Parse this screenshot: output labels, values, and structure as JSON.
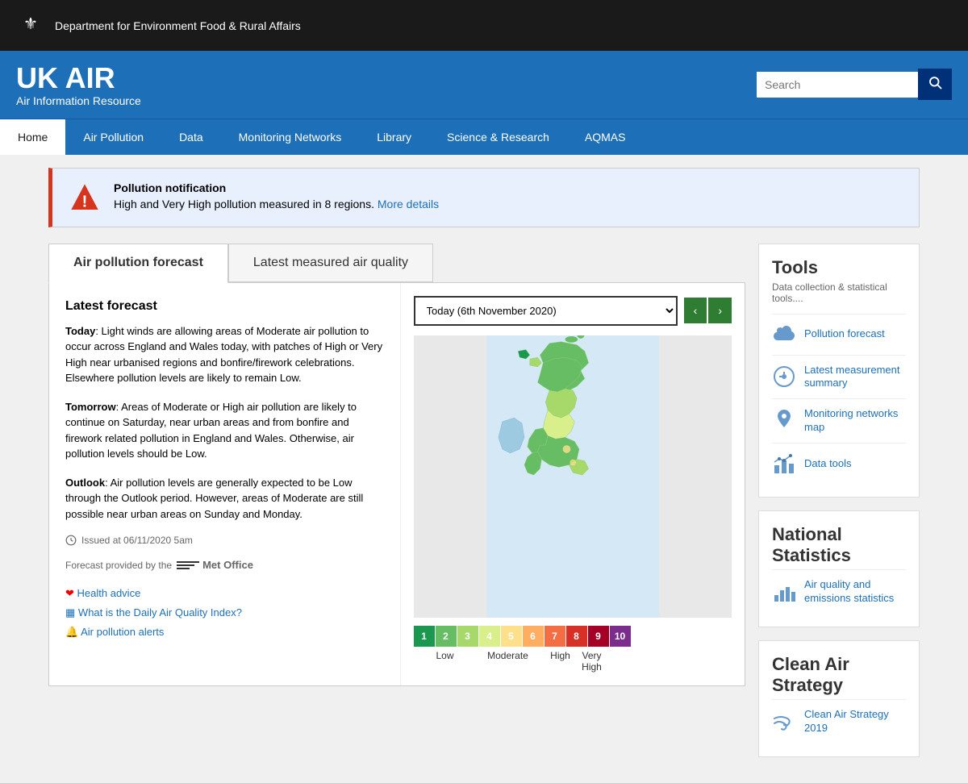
{
  "govbar": {
    "crest": "⚜",
    "dept": "Department for Environment Food & Rural Affairs"
  },
  "header": {
    "title": "UK AIR",
    "tagline": "Air Information Resource",
    "search_placeholder": "Search",
    "search_label": "Search"
  },
  "nav": {
    "items": [
      {
        "label": "Home",
        "active": true
      },
      {
        "label": "Air Pollution",
        "active": false
      },
      {
        "label": "Data",
        "active": false
      },
      {
        "label": "Monitoring Networks",
        "active": false
      },
      {
        "label": "Library",
        "active": false
      },
      {
        "label": "Science & Research",
        "active": false
      },
      {
        "label": "AQMAS",
        "active": false
      }
    ]
  },
  "notification": {
    "title": "Pollution notification",
    "body": "High and Very High pollution measured in 8 regions.",
    "link": "More details"
  },
  "tabs": {
    "tab1": "Air pollution forecast",
    "tab2": "Latest measured air quality"
  },
  "forecast": {
    "section_title": "Latest forecast",
    "today_label": "Today",
    "today_text": ": Light winds are allowing areas of Moderate air pollution to occur across England and Wales today, with patches of High or Very High near urbanised regions and bonfire/firework celebrations. Elsewhere pollution levels are likely to remain Low.",
    "tomorrow_label": "Tomorrow",
    "tomorrow_text": ": Areas of Moderate or High air pollution are likely to continue on Saturday, near urban areas and from bonfire and firework related pollution in England and Wales. Otherwise, air pollution levels should be Low.",
    "outlook_label": "Outlook",
    "outlook_text": ": Air pollution levels are generally expected to be Low through the Outlook period. However, areas of Moderate are still possible near urban areas on Sunday and Monday.",
    "issued": "Issued at 06/11/2020 5am",
    "provider": "Forecast provided by the",
    "provider_name": "Met Office"
  },
  "links": {
    "health_advice": "Health advice",
    "daily_index": "What is the Daily Air Quality Index?",
    "alerts": "Air pollution alerts"
  },
  "aq": {
    "date_label": "Today (6th November 2020)",
    "prev_btn": "‹",
    "next_btn": "›"
  },
  "scale": {
    "items": [
      {
        "num": "1",
        "color": "#1a9850"
      },
      {
        "num": "2",
        "color": "#66bd63"
      },
      {
        "num": "3",
        "color": "#a6d96a"
      },
      {
        "num": "4",
        "color": "#d9ef8b"
      },
      {
        "num": "5",
        "color": "#fee08b"
      },
      {
        "num": "6",
        "color": "#fdae61"
      },
      {
        "num": "7",
        "color": "#f46d43"
      },
      {
        "num": "8",
        "color": "#d73027"
      },
      {
        "num": "9",
        "color": "#a50026"
      },
      {
        "num": "10",
        "color": "#7b2d8b"
      }
    ],
    "labels": [
      {
        "text": "Low",
        "span": 3
      },
      {
        "text": "Moderate",
        "span": 3
      },
      {
        "text": "High",
        "span": 3
      },
      {
        "text": "Very High",
        "span": 1
      }
    ]
  },
  "sidebar": {
    "tools": {
      "title": "Tools",
      "desc": "Data collection & statistical tools....",
      "links": [
        {
          "label": "Pollution forecast",
          "icon": "cloud"
        },
        {
          "label": "Latest measurement summary",
          "icon": "gauge"
        },
        {
          "label": "Monitoring networks map",
          "icon": "pin"
        },
        {
          "label": "Data tools",
          "icon": "chart"
        }
      ]
    },
    "national_stats": {
      "title": "National Statistics",
      "links": [
        {
          "label": "Air quality and emissions statistics",
          "icon": "bar-chart"
        }
      ]
    },
    "clean_air": {
      "title": "Clean Air Strategy",
      "links": [
        {
          "label": "Clean Air Strategy 2019",
          "icon": "wind"
        }
      ]
    }
  }
}
